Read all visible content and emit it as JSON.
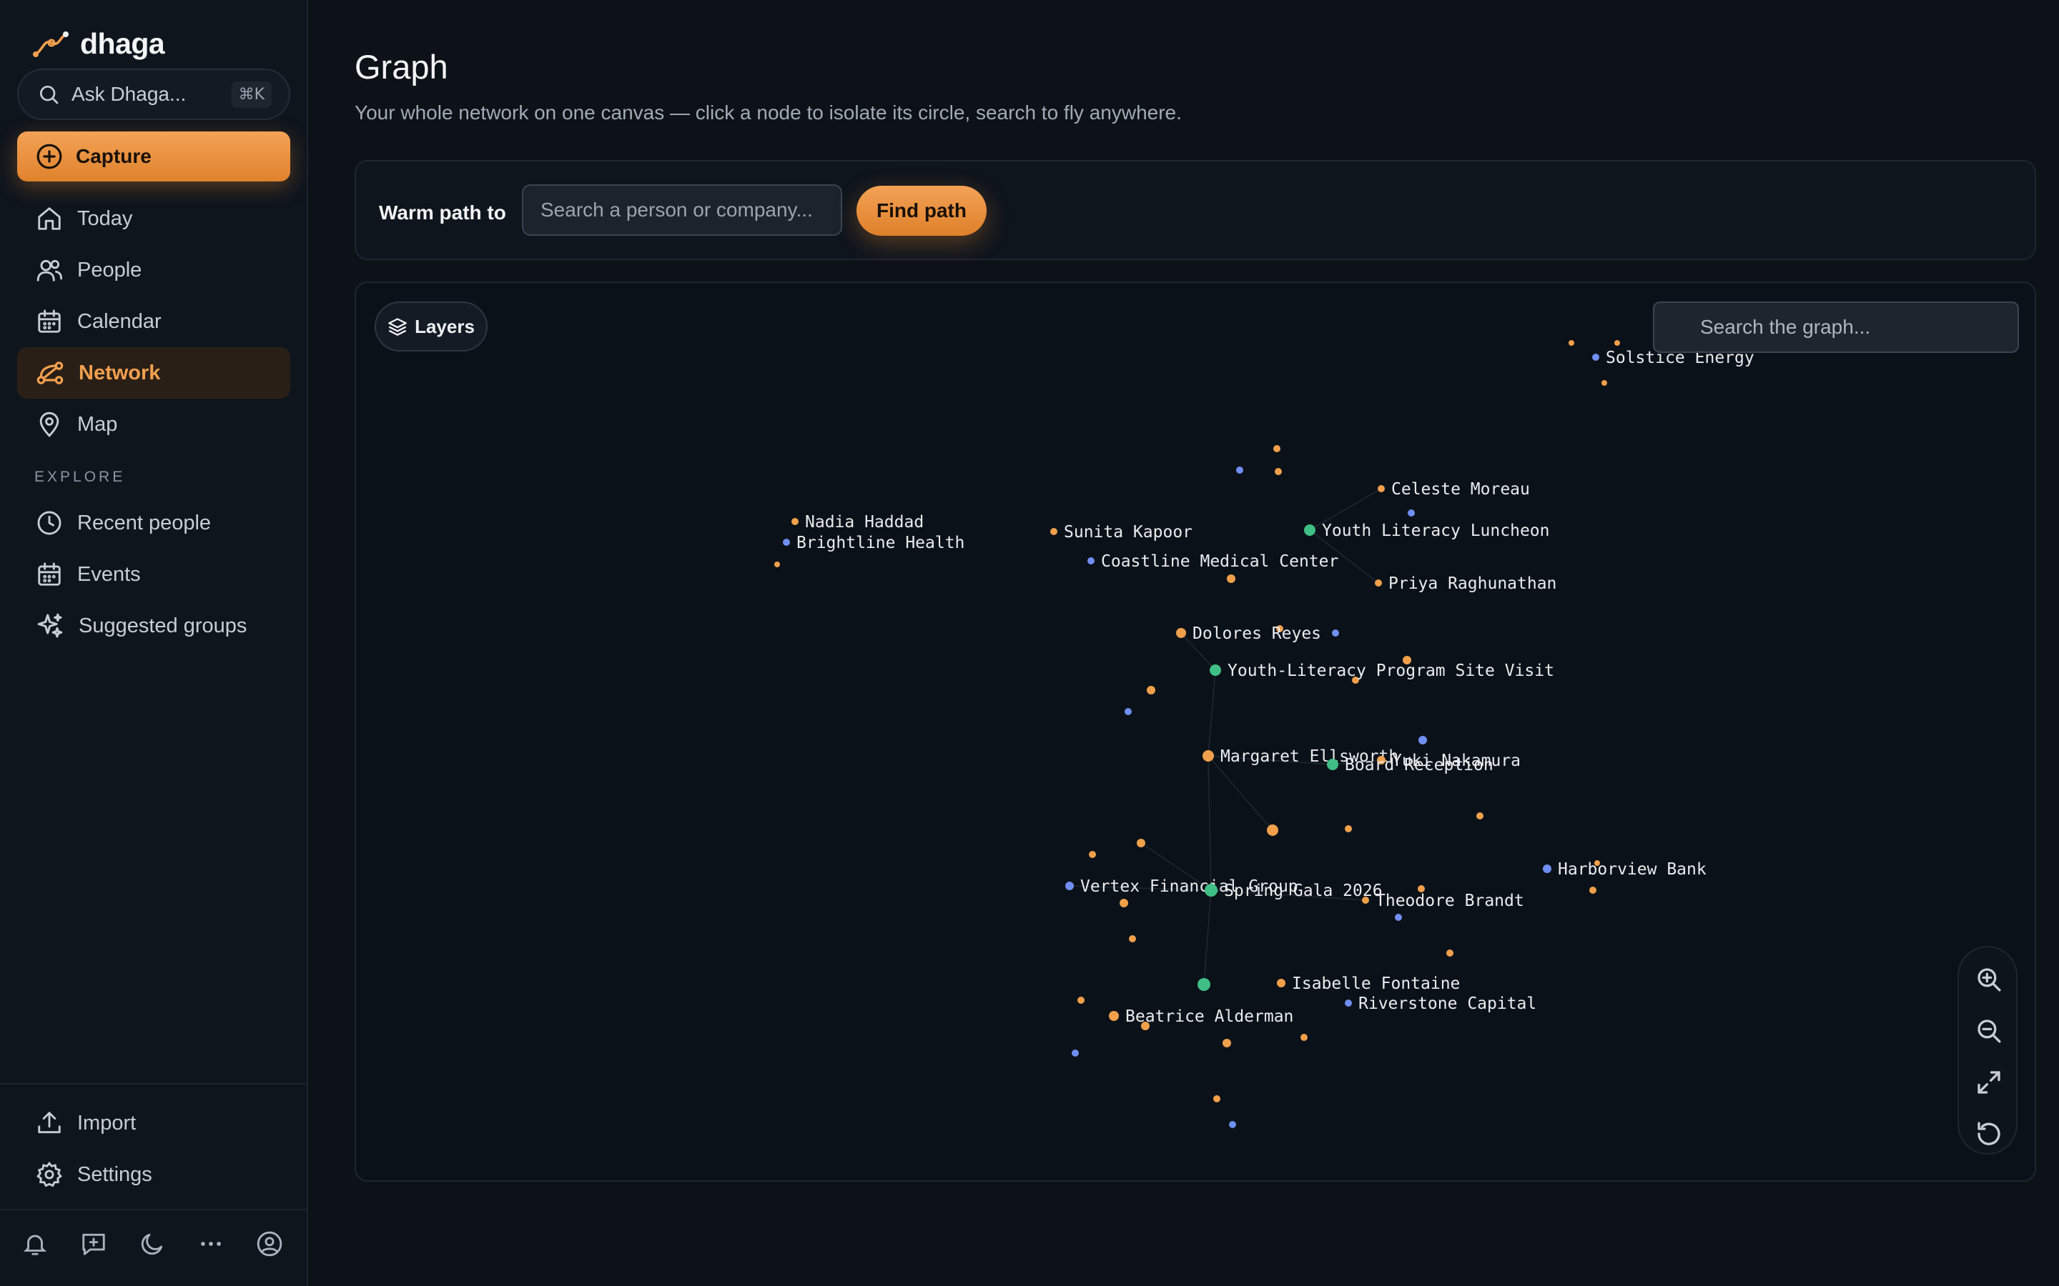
{
  "app": {
    "name": "dhaga"
  },
  "sidebar": {
    "search_label": "Ask Dhaga...",
    "search_shortcut": "⌘K",
    "capture_label": "Capture",
    "nav": [
      {
        "label": "Today",
        "icon": "home-icon"
      },
      {
        "label": "People",
        "icon": "people-icon"
      },
      {
        "label": "Calendar",
        "icon": "calendar-icon"
      },
      {
        "label": "Network",
        "icon": "network-icon",
        "active": true
      },
      {
        "label": "Map",
        "icon": "map-pin-icon"
      }
    ],
    "explore_label": "EXPLORE",
    "explore": [
      {
        "label": "Recent people",
        "icon": "clock-icon"
      },
      {
        "label": "Events",
        "icon": "calendar-icon"
      },
      {
        "label": "Suggested groups",
        "icon": "sparkles-icon"
      }
    ],
    "footer": [
      {
        "label": "Import",
        "icon": "upload-icon"
      },
      {
        "label": "Settings",
        "icon": "gear-icon"
      }
    ],
    "bottom_icons": [
      "bell-icon",
      "message-plus-icon",
      "moon-icon",
      "more-icon",
      "user-circle-icon"
    ]
  },
  "page": {
    "title": "Graph",
    "subtitle": "Your whole network on one canvas — click a node to isolate its circle, search to fly anywhere."
  },
  "warm_path": {
    "label": "Warm path to",
    "placeholder": "Search a person or company...",
    "button": "Find path"
  },
  "graph": {
    "layers_label": "Layers",
    "search_placeholder": "Search the graph...",
    "zoom_controls": [
      "zoom-in-icon",
      "zoom-out-icon",
      "fit-screen-icon",
      "reset-icon"
    ],
    "colors": {
      "person": "#f0a04b",
      "company": "#6f8ff2",
      "event": "#3fbf85"
    },
    "labels": [
      "Solstice Energy",
      "Celeste Moreau",
      "Youth Literacy Luncheon",
      "Nadia Haddad",
      "Brightline Health",
      "Sunita Kapoor",
      "Coastline Medical Center",
      "Priya Raghunathan",
      "Dolores Reyes",
      "Youth-Literacy Program Site Visit",
      "Margaret Ellsworth",
      "Yuki Nakamura",
      "Board Reception",
      "Harborview Bank",
      "Vertex Financial Group",
      "Spring Gala 2026",
      "Theodore Brandt",
      "Isabelle Fontaine",
      "Riverstone Capital",
      "Beatrice Alderman"
    ]
  }
}
